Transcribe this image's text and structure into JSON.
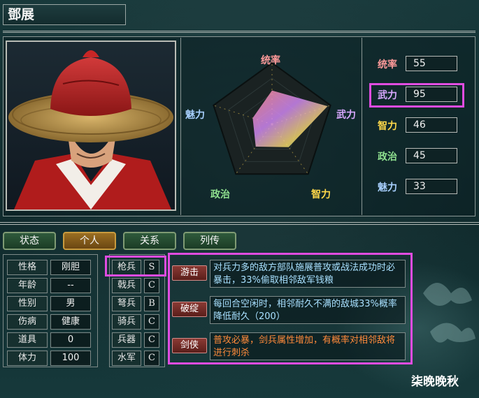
{
  "officer_name": "鄧展",
  "radar": {
    "labels": [
      "统率",
      "武力",
      "智力",
      "政治",
      "魅力"
    ],
    "label_colors": [
      "#ff9a9a",
      "#d9a8ff",
      "#ffd84a",
      "#8fe08f",
      "#a8d0ff"
    ],
    "max": 100,
    "values": [
      55,
      95,
      46,
      45,
      33
    ]
  },
  "stats": [
    {
      "label": "统率",
      "value": "55",
      "color": "#ff9a9a"
    },
    {
      "label": "武力",
      "value": "95",
      "color": "#d9a8ff"
    },
    {
      "label": "智力",
      "value": "46",
      "color": "#ffd84a"
    },
    {
      "label": "政治",
      "value": "45",
      "color": "#8fe08f"
    },
    {
      "label": "魅力",
      "value": "33",
      "color": "#a8d0ff"
    }
  ],
  "tabs": [
    {
      "label": "状态",
      "active": false
    },
    {
      "label": "个人",
      "active": true
    },
    {
      "label": "关系",
      "active": false
    },
    {
      "label": "列传",
      "active": false
    }
  ],
  "info": [
    {
      "label": "性格",
      "value": "刚胆"
    },
    {
      "label": "年龄",
      "value": "--"
    },
    {
      "label": "性别",
      "value": "男"
    },
    {
      "label": "伤病",
      "value": "健康"
    },
    {
      "label": "道具",
      "value": "0"
    },
    {
      "label": "体力",
      "value": "100"
    }
  ],
  "troops": [
    {
      "name": "枪兵",
      "grade": "S"
    },
    {
      "name": "戟兵",
      "grade": "C"
    },
    {
      "name": "弩兵",
      "grade": "B"
    },
    {
      "name": "骑兵",
      "grade": "C"
    },
    {
      "name": "兵器",
      "grade": "C"
    },
    {
      "name": "水军",
      "grade": "C"
    }
  ],
  "skills": [
    {
      "name": "游击",
      "desc": "对兵力多的敌方部队施展普攻或战法成功时必暴击，33%偷取相邻敌军钱粮",
      "color": "#a8e0ff"
    },
    {
      "name": "破绽",
      "desc": "每回合空闲时，相邻耐久不满的敌城33%概率降低耐久（200）",
      "color": "#a8e0ff"
    },
    {
      "name": "剑侠",
      "desc": "普攻必暴，剑兵属性增加，有概率对相邻敌将进行刺杀",
      "color": "#ff8a3a"
    }
  ],
  "watermark": "柒晚晚秋"
}
